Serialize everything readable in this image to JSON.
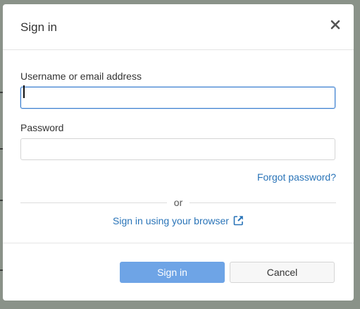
{
  "dialog": {
    "title": "Sign in",
    "close_icon": "close-icon"
  },
  "form": {
    "username_label": "Username or email address",
    "username_value": "",
    "password_label": "Password",
    "password_value": "",
    "forgot_password": "Forgot password?",
    "divider_text": "or",
    "browser_signin": "Sign in using your browser",
    "browser_signin_icon": "external-link-icon"
  },
  "footer": {
    "sign_in_label": "Sign in",
    "cancel_label": "Cancel"
  },
  "colors": {
    "primary_button": "#6ea4e6",
    "link": "#2a74b8",
    "focus_border": "#3a7ed0"
  }
}
